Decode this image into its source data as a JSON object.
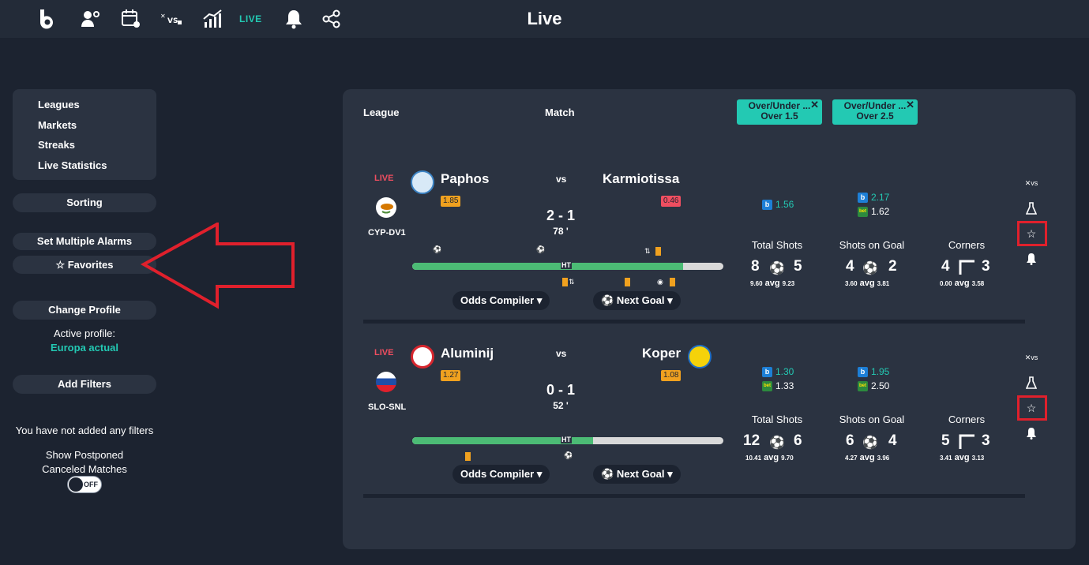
{
  "header": {
    "title": "Live",
    "live_label": "LIVE"
  },
  "sidebar": {
    "menu": [
      "Leagues",
      "Markets",
      "Streaks",
      "Live Statistics"
    ],
    "sorting": "Sorting",
    "set_alarms": "Set Multiple Alarms",
    "favorites": "☆ Favorites",
    "change_profile": "Change Profile",
    "active_profile_label": "Active profile:",
    "active_profile_value": "Europa actual",
    "add_filters": "Add Filters",
    "no_filters": "You have not added any filters",
    "postponed_line1": "Show Postponed",
    "postponed_line2": "Canceled Matches",
    "toggle_label": "OFF"
  },
  "table": {
    "col_league": "League",
    "col_match": "Match",
    "markets": [
      {
        "line1": "Over/Under ...",
        "line2": "Over 1.5"
      },
      {
        "line1": "Over/Under ...",
        "line2": "Over 2.5"
      }
    ]
  },
  "matches": [
    {
      "live": "LIVE",
      "league": "CYP-DV1",
      "home": "Paphos",
      "away": "Karmiotissa",
      "vs": "vs",
      "home_rating": "1.85",
      "away_rating": "0.46",
      "score": "2 - 1",
      "minute": "78 '",
      "ht": "HT",
      "timeline_progress": 0.87,
      "odds_compiler": "Odds Compiler",
      "next_goal": "Next Goal",
      "m1_b": "1.56",
      "m2_b": "2.17",
      "m2_365": "1.62",
      "stats": [
        {
          "title": "Total Shots",
          "home": "8",
          "away": "5",
          "home_avg": "9.60",
          "away_avg": "9.23"
        },
        {
          "title": "Shots on Goal",
          "home": "4",
          "away": "2",
          "home_avg": "3.60",
          "away_avg": "3.81"
        },
        {
          "title": "Corners",
          "home": "4",
          "away": "3",
          "home_avg": "0.00",
          "away_avg": "3.58"
        }
      ]
    },
    {
      "live": "LIVE",
      "league": "SLO-SNL",
      "home": "Aluminij",
      "away": "Koper",
      "vs": "vs",
      "home_rating": "1.27",
      "away_rating": "1.08",
      "score": "0 - 1",
      "minute": "52 '",
      "ht": "HT",
      "timeline_progress": 0.58,
      "odds_compiler": "Odds Compiler",
      "next_goal": "Next Goal",
      "m1_b": "1.30",
      "m1_365": "1.33",
      "m2_b": "1.95",
      "m2_365": "2.50",
      "stats": [
        {
          "title": "Total Shots",
          "home": "12",
          "away": "6",
          "home_avg": "10.41",
          "away_avg": "9.70"
        },
        {
          "title": "Shots on Goal",
          "home": "6",
          "away": "4",
          "home_avg": "4.27",
          "away_avg": "3.96"
        },
        {
          "title": "Corners",
          "home": "5",
          "away": "3",
          "home_avg": "3.41",
          "away_avg": "3.13"
        }
      ]
    }
  ],
  "avg_label": "avg",
  "colors": {
    "accent": "#23c9b3",
    "live": "#ef4e60",
    "highlight": "#e0202c",
    "progress": "#4cbc75",
    "card": "#f0a11f"
  }
}
